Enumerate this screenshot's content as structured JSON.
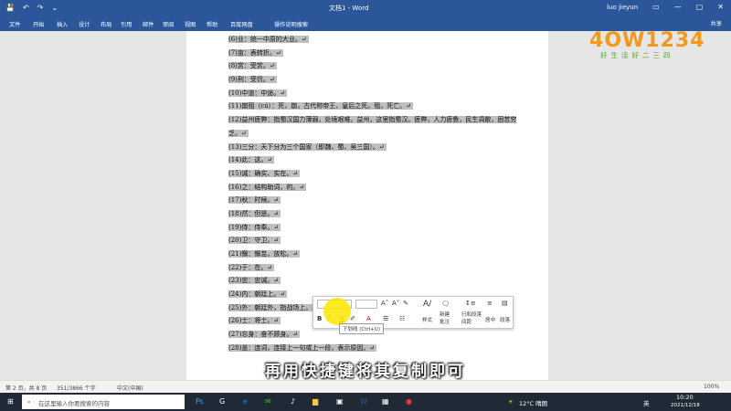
{
  "titlebar": {
    "doc_title": "文档1 - Word",
    "user": "luo jieyun",
    "icons": [
      "save-icon",
      "undo-icon",
      "redo-icon",
      "customize-icon"
    ],
    "controls": [
      "minimize-icon",
      "restore-icon",
      "close-icon"
    ]
  },
  "tabs": [
    "文件",
    "开始",
    "插入",
    "设计",
    "布局",
    "引用",
    "邮件",
    "审阅",
    "视图",
    "帮助",
    "百度网盘",
    "操作说明搜索"
  ],
  "share_label": "共享",
  "document_lines": [
    {
      "text": "(6)业：统一中原的大业。↵"
    },
    {
      "text": "(7)亩：表转折。↵"
    },
    {
      "text": "(8)赏：受赏。↵"
    },
    {
      "text": "(9)刑：受罚。↵"
    },
    {
      "text": "(10)中道：中途。↵"
    },
    {
      "text": "(11)崩殂（cú）：死，崩，古代称帝王、皇后之死。殂，死亡。↵"
    },
    {
      "text": "(12)益州疲弊：指蜀汉国力薄弱，处境艰难。益州，这里指蜀汉。疲弊，人力疲惫，民生凋敝，困苦穷乏。↵",
      "wrap": true
    },
    {
      "text": "(13)三分：天下分为三个国家（即魏、蜀、吴三国）。↵"
    },
    {
      "text": "(14)此：这。↵"
    },
    {
      "text": "(15)诚：确实、实在。↵"
    },
    {
      "text": "(16)之：结构助词，的。↵"
    },
    {
      "text": "(17)秋：时候。↵"
    },
    {
      "text": "(18)然：但是。↵"
    },
    {
      "text": "(19)侍：侍奉。↵"
    },
    {
      "text": "(20)卫：守卫。↵"
    },
    {
      "text": "(21)懈：懈怠，放松。↵"
    },
    {
      "text": "(22)于：在。↵"
    },
    {
      "text": "(23)忠：忠诚。↵"
    },
    {
      "text": "(24)内：朝廷上。↵"
    },
    {
      "text": "(25)外：朝廷外，指战场上。↵"
    },
    {
      "text": "(26)士：将士。↵"
    },
    {
      "text": "(27)忘身：奋不顾身。↵"
    },
    {
      "text": "(28)盖：连词，连接上一句或上一段，表示原因。↵"
    }
  ],
  "logo": {
    "brand": "4OW1234",
    "tagline": "好生活好二三四"
  },
  "minibar": {
    "font_value": "",
    "size_value": "",
    "styles_label": "样式",
    "new_comment_label": "新建批注",
    "line_spacing_label": "行和段落间距",
    "center_label": "居中",
    "paragraph_label": "段落"
  },
  "tooltip": "下划线 (Ctrl+U)",
  "subtitle": "再用快捷键将其复制即可",
  "status": {
    "page": "第 2 页，共 8 页",
    "words": "351/3866 个字",
    "lang": "中文(中国)",
    "zoom": "100%"
  },
  "taskbar": {
    "search_placeholder": "在这里输入你要搜索的内容",
    "weather": "12°C 晴朗",
    "ime": "英",
    "time": "10:20",
    "date": "2021/12/18"
  },
  "colors": {
    "ribbon": "#2b579a",
    "highlight": "#bfbfbf",
    "logo_orange": "#f39a1d",
    "logo_green": "#5a9e2a"
  }
}
